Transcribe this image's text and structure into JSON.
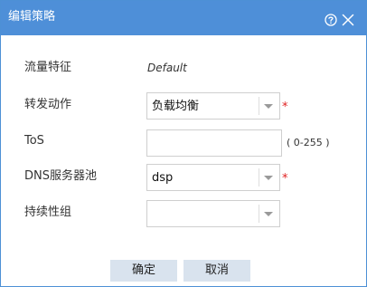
{
  "dialog": {
    "title": "编辑策略",
    "icons": {
      "help": "help-circle-icon",
      "close": "close-x-icon"
    }
  },
  "form": {
    "traffic_feature": {
      "label": "流量特征",
      "value": "Default"
    },
    "forward_action": {
      "label": "转发动作",
      "value": "负载均衡",
      "required_mark": "*"
    },
    "tos": {
      "label": "ToS",
      "value": "",
      "hint": "( 0-255 )"
    },
    "dns_pool": {
      "label": "DNS服务器池",
      "value": "dsp",
      "required_mark": "*"
    },
    "persistence_group": {
      "label": "持续性组",
      "value": ""
    }
  },
  "buttons": {
    "ok": "确定",
    "cancel": "取消"
  },
  "colors": {
    "titlebar": "#4e8fd8",
    "button_bg": "#d9e3ee",
    "required": "#e02020",
    "border": "#cfcfcf"
  }
}
